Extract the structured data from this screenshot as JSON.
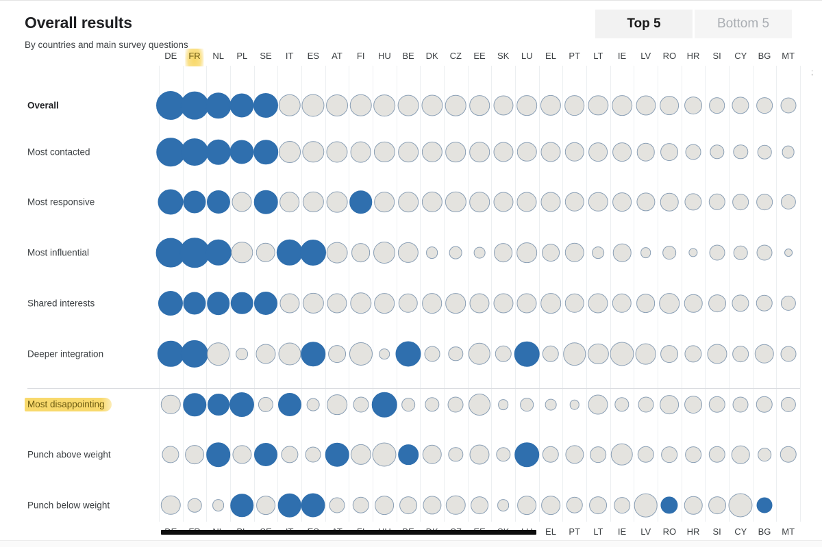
{
  "header": {
    "title": "Overall results",
    "subtitle": "By countries and main survey questions",
    "tabs": [
      {
        "label": "Top 5",
        "active": true
      },
      {
        "label": "Bottom 5",
        "active": false
      }
    ]
  },
  "colors": {
    "filled": "#2f6fae",
    "hollow_fill": "#e4e3df",
    "hollow_stroke": "#8a9fb5",
    "highlight": "#f8d660",
    "gridline": "#eceff1",
    "separator": "#dadce0",
    "text": "#3c4043"
  },
  "annotations": {
    "highlighted_column": "FR",
    "highlighted_row": "Most disappointing",
    "edge_mark": ";"
  },
  "chart_data": {
    "type": "heatmap",
    "title": "Overall results",
    "subtitle": "By countries and main survey questions",
    "xlabel": "",
    "ylabel": "",
    "legend": "Top 5 highlighted in solid blue; remaining countries shown as hollow bubbles. Bubble area encodes score.",
    "grid": true,
    "value_range": [
      0,
      100
    ],
    "categories": [
      "DE",
      "FR",
      "NL",
      "PL",
      "SE",
      "IT",
      "ES",
      "AT",
      "FI",
      "HU",
      "BE",
      "DK",
      "CZ",
      "EE",
      "SK",
      "LU",
      "EL",
      "PT",
      "LT",
      "IE",
      "LV",
      "RO",
      "HR",
      "SI",
      "CY",
      "BG",
      "MT"
    ],
    "rows": [
      "Overall",
      "Most contacted",
      "Most responsive",
      "Most influential",
      "Shared interests",
      "Deeper integration",
      "Most disappointing",
      "Punch above weight",
      "Punch below weight"
    ],
    "separator_after_row": "Shared interests",
    "series": [
      {
        "name": "Overall",
        "bold": true,
        "values": [
          100,
          94,
          80,
          70,
          74,
          60,
          62,
          58,
          60,
          57,
          54,
          55,
          53,
          50,
          48,
          50,
          52,
          50,
          49,
          50,
          48,
          44,
          38,
          32,
          36,
          32,
          30
        ],
        "top5": [
          "DE",
          "FR",
          "NL",
          "PL",
          "SE"
        ]
      },
      {
        "name": "Most contacted",
        "values": [
          98,
          90,
          76,
          70,
          72,
          58,
          56,
          55,
          54,
          52,
          50,
          52,
          50,
          50,
          48,
          46,
          48,
          46,
          44,
          44,
          40,
          38,
          30,
          26,
          26,
          24,
          20
        ],
        "top5": [
          "DE",
          "FR",
          "NL",
          "PL",
          "SE"
        ]
      },
      {
        "name": "Most responsive",
        "values": [
          78,
          62,
          66,
          48,
          68,
          50,
          52,
          54,
          64,
          50,
          50,
          52,
          52,
          50,
          48,
          48,
          48,
          46,
          46,
          44,
          42,
          40,
          36,
          34,
          32,
          32,
          28
        ],
        "top5": [
          "DE",
          "FR",
          "NL",
          "SE",
          "FI"
        ]
      },
      {
        "name": "Most influential",
        "values": [
          104,
          108,
          84,
          56,
          46,
          84,
          82,
          54,
          44,
          58,
          52,
          18,
          20,
          16,
          44,
          50,
          38,
          46,
          18,
          40,
          14,
          22,
          10,
          30,
          24,
          30,
          8
        ],
        "top5": [
          "DE",
          "FR",
          "NL",
          "IT",
          "ES"
        ]
      },
      {
        "name": "Shared interests",
        "values": [
          74,
          62,
          64,
          60,
          66,
          48,
          52,
          48,
          56,
          50,
          46,
          50,
          50,
          48,
          48,
          48,
          50,
          46,
          48,
          46,
          44,
          50,
          40,
          38,
          36,
          34,
          28
        ],
        "top5": [
          "DE",
          "FR",
          "NL",
          "PL",
          "SE"
        ]
      },
      {
        "name": "Deeper integration",
        "values": [
          84,
          92,
          64,
          18,
          48,
          62,
          72,
          38,
          66,
          14,
          78,
          30,
          26,
          60,
          34,
          76,
          34,
          64,
          52,
          70,
          54,
          38,
          36,
          48,
          32,
          46,
          30
        ],
        "top5": [
          "DE",
          "FR",
          "ES",
          "BE",
          "LU"
        ]
      },
      {
        "name": "Most disappointing",
        "values": [
          46,
          64,
          58,
          74,
          28,
          66,
          20,
          50,
          30,
          76,
          22,
          26,
          30,
          58,
          14,
          22,
          16,
          12,
          48,
          26,
          30,
          44,
          38,
          34,
          30,
          34,
          28
        ],
        "top5": [
          "FR",
          "NL",
          "PL",
          "IT",
          "HU"
        ]
      },
      {
        "name": "Punch above weight",
        "values": [
          36,
          44,
          72,
          42,
          66,
          36,
          30,
          68,
          52,
          70,
          50,
          46,
          26,
          48,
          26,
          72,
          34,
          42,
          32,
          60,
          34,
          32,
          32,
          34,
          40,
          22,
          34
        ],
        "top5": [
          "NL",
          "SE",
          "AT",
          "BE",
          "LU"
        ]
      },
      {
        "name": "Punch below weight",
        "values": [
          46,
          24,
          18,
          64,
          44,
          68,
          70,
          30,
          34,
          44,
          38,
          42,
          46,
          38,
          18,
          44,
          44,
          34,
          38,
          32,
          68,
          36,
          40,
          38,
          70,
          30,
          0
        ],
        "top5": [
          "PL",
          "IT",
          "ES",
          "RO",
          "BG"
        ]
      }
    ]
  }
}
